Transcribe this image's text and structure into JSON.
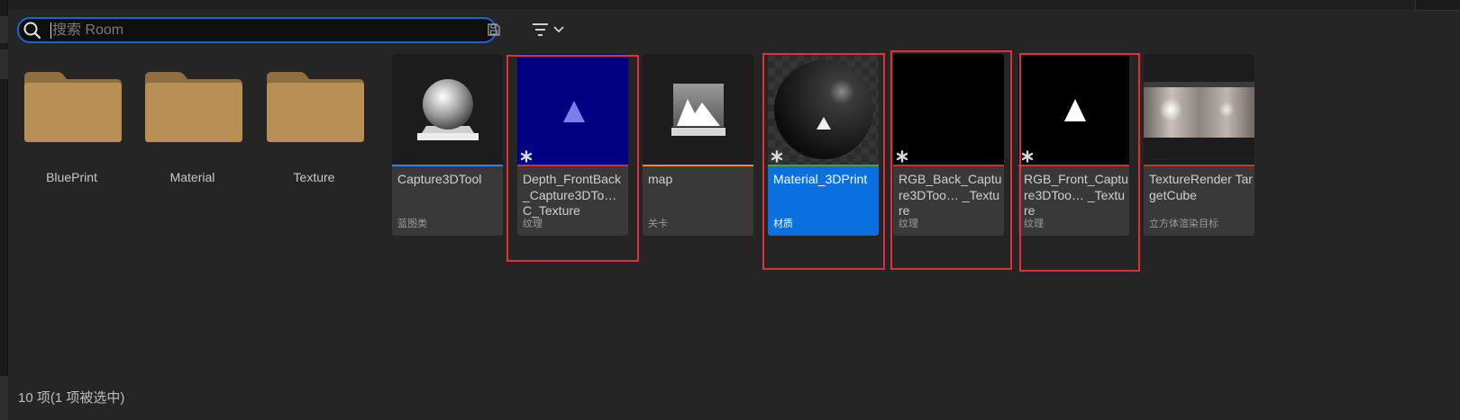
{
  "search": {
    "placeholder": "搜索 Room"
  },
  "toolbar": {
    "save_icon": "save-icon",
    "filter_icon": "filter-icon"
  },
  "folders": [
    {
      "label": "BluePrint"
    },
    {
      "label": "Material"
    },
    {
      "label": "Texture"
    }
  ],
  "assets": [
    {
      "name": "Capture3DTool",
      "type": "蓝图类",
      "thumb": "sphere-icon",
      "bar_color": "#3d7be8"
    },
    {
      "name": "Depth_FrontBack_Capture3DTo… C_Texture",
      "type": "纹理",
      "thumb": "texture-blue",
      "bar_color": "#c0392b"
    },
    {
      "name": "map",
      "type": "关卡",
      "thumb": "map-icon",
      "bar_color": "#e8912a"
    },
    {
      "name": "Material_3DPrint",
      "type": "材质",
      "thumb": "material-sphere",
      "bar_color": "#3fa34d",
      "selected": true
    },
    {
      "name": "RGB_Back_Capture3DToo… _Texture",
      "type": "纹理",
      "thumb": "texture-black",
      "bar_color": "#c0392b"
    },
    {
      "name": "RGB_Front_Capture3DToo… _Texture",
      "type": "纹理",
      "thumb": "texture-black-triangle",
      "bar_color": "#c0392b"
    },
    {
      "name": "TextureRender TargetCube",
      "type": "立方体渲染目标",
      "thumb": "cube-panorama",
      "bar_color": "#c0392b"
    }
  ],
  "status": {
    "text": "10 项(1 项被选中)"
  },
  "colors": {
    "accent": "#0a6fdf",
    "highlight_box": "#e0303a",
    "background": "#252525"
  }
}
